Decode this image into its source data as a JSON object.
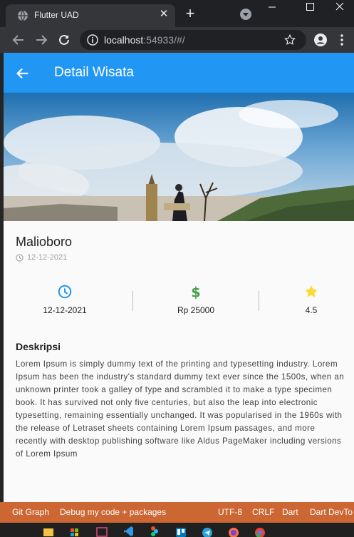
{
  "browser": {
    "tab_title": "Flutter UAD",
    "tab_close": "✕",
    "new_tab": "+",
    "url_host": "localhost",
    "url_rest": ":54933/#/"
  },
  "app": {
    "appbar_title": "Detail Wisata",
    "place_name": "Malioboro",
    "place_date": "12-12-2021",
    "info": [
      {
        "icon": "clock-icon",
        "text": "12-12-2021"
      },
      {
        "icon": "dollar-icon",
        "text": "Rp 25000"
      },
      {
        "icon": "star-icon",
        "text": "4.5"
      }
    ],
    "description_title": "Deskripsi",
    "description": "Lorem Ipsum is simply dummy text of the printing and typesetting industry. Lorem Ipsum has been the industry's standard dummy text ever since the 1500s, when an unknown printer took a galley of type and scrambled it to make a type specimen book. It has survived not only five centuries, but also the leap into electronic typesetting, remaining essentially unchanged. It was popularised in the 1960s with the release of Letraset sheets containing Lorem Ipsum passages, and more recently with desktop publishing software like Aldus PageMaker including versions of Lorem Ipsum"
  },
  "statusbar": {
    "git_graph": "Git Graph",
    "debug": "Debug my code + packages",
    "encoding": "UTF-8",
    "eol": "CRLF",
    "language": "Dart",
    "devtools": "Dart DevTo"
  },
  "colors": {
    "appbar": "#2196f3",
    "clock_icon": "#2196f3",
    "dollar_icon": "#43a047",
    "star_icon": "#fdd835",
    "statusbar": "#cc6633"
  }
}
